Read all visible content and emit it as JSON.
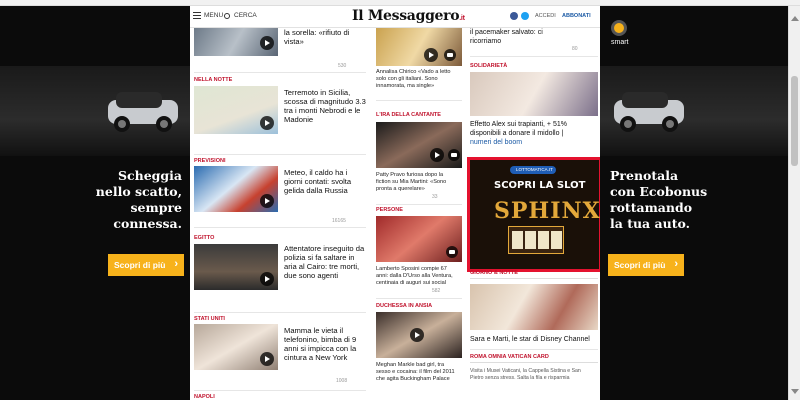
{
  "header": {
    "menu_label": "MENU",
    "search_label": "CERCA",
    "logo": "Il Messaggero",
    "logo_suffix": ".it",
    "accedi_label": "ACCEDI",
    "abbonati_label": "ABBONATI"
  },
  "ad_left": {
    "brand": "smart",
    "text_lines": [
      "Scheggia",
      "nello scatto,",
      "sempre",
      "connessa."
    ],
    "button_label": "Scopri di più"
  },
  "ad_right": {
    "text_lines": [
      "Prenotala",
      "con Ecobonus",
      "rottamando",
      "la tua auto."
    ],
    "button_label": "Scopri di più"
  },
  "col1": [
    {
      "section": "",
      "title_lines": [
        "la sorella: «rifiuto di",
        "vista»"
      ],
      "meta": "530"
    },
    {
      "section": "NELLA NOTTE",
      "title_lines": [
        "Terremoto in Sicilia,",
        "scossa di magnitudo 3.3",
        "tra i monti Nebrodi e le",
        "Madonie"
      ],
      "meta": ""
    },
    {
      "section": "PREVISIONI",
      "title_lines": [
        "Meteo, il caldo ha i",
        "giorni contati: svolta",
        "gelida dalla Russia"
      ],
      "meta": "16165"
    },
    {
      "section": "EGITTO",
      "title_lines": [
        "Attentatore inseguito da",
        "polizia si fa saltare in",
        "aria al Cairo: tre morti,",
        "due sono agenti"
      ],
      "meta": ""
    },
    {
      "section": "STATI UNITI",
      "title_lines": [
        "Mamma le vieta il",
        "telefonino, bimba di 9",
        "anni si impicca con la",
        "cintura a New York"
      ],
      "meta": "1008"
    },
    {
      "section": "NAPOLI",
      "title_lines": [],
      "meta": ""
    }
  ],
  "col2": [
    {
      "section": "",
      "title_lines": [
        "Annalisa Chirico «Vado a letto",
        "solo con gli italiani. Sono",
        "innamorata, ma single»"
      ],
      "meta": ""
    },
    {
      "section": "L'IRA DELLA CANTANTE",
      "title_lines": [
        "Patty Pravo furiosa dopo la",
        "fiction su Mia Martini: «Sono",
        "pronta a querelare»"
      ],
      "meta": "33"
    },
    {
      "section": "PERSONE",
      "title_lines": [
        "Lamberto Sposini compie 67",
        "anni: dalla D'Urso alla Ventura,",
        "centinaia di auguri sui social"
      ],
      "meta": "582"
    },
    {
      "section": "DUCHESSA IN ANSIA",
      "title_lines": [
        "Meghan Markle bad girl, tra",
        "sesso e cocaina: il film del 2011",
        "che agita Buckingham Palace"
      ],
      "meta": ""
    }
  ],
  "col3": [
    {
      "section": "",
      "title_lines": [
        "il pacemaker salvato: ci",
        "ricorriamo"
      ],
      "meta": "80"
    },
    {
      "section": "SOLIDARIETÀ",
      "title_lines": [
        "Effetto Alex sui trapianti, + 51%",
        "disponibili a donare il midollo |",
        "numeri del boom"
      ],
      "meta": ""
    },
    {
      "section": "GIORNO & NOTTE",
      "title_lines": [
        "Sara e Marti, le star di Disney Channel"
      ],
      "meta": ""
    },
    {
      "section": "ROMA OMNIA VATICAN CARD",
      "title_lines": [
        "Visita i Musei Vaticani, la Cappella Sistina e San",
        "Pietro senza stress. Salta la fila e risparmia"
      ],
      "meta": ""
    }
  ],
  "promo": {
    "logo": "LOTTOMATICA.IT",
    "title": "SCOPRI LA SLOT",
    "game": "SPHINX"
  },
  "colors": {
    "accent": "#c0122c",
    "ad_button": "#f7b21b",
    "promo_border": "#e4122f"
  }
}
